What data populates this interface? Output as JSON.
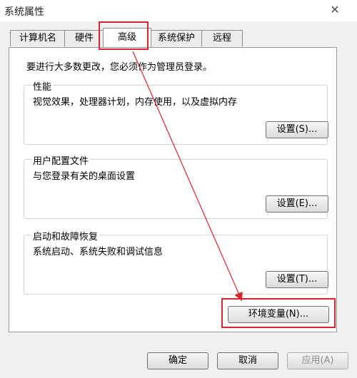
{
  "window": {
    "title": "系统属性",
    "close_glyph": "✕"
  },
  "tabs": [
    {
      "label": "计算机名",
      "active": false
    },
    {
      "label": "硬件",
      "active": false
    },
    {
      "label": "高级",
      "active": true
    },
    {
      "label": "系统保护",
      "active": false
    },
    {
      "label": "远程",
      "active": false
    }
  ],
  "advanced": {
    "intro": "要进行大多数更改，您必须作为管理员登录。",
    "performance": {
      "title": "性能",
      "description": "视觉效果，处理器计划，内存使用，以及虚拟内存",
      "button": "设置(S)..."
    },
    "user_profiles": {
      "title": "用户配置文件",
      "description": "与您登录有关的桌面设置",
      "button": "设置(E)..."
    },
    "startup_recovery": {
      "title": "启动和故障恢复",
      "description": "系统启动、系统失败和调试信息",
      "button": "设置(T)..."
    },
    "env_button": "环境变量(N)..."
  },
  "footer": {
    "ok": "确定",
    "cancel": "取消",
    "apply": "应用(A)"
  },
  "colors": {
    "highlight": "#d9262b",
    "window_bg": "#f0f0f0"
  }
}
